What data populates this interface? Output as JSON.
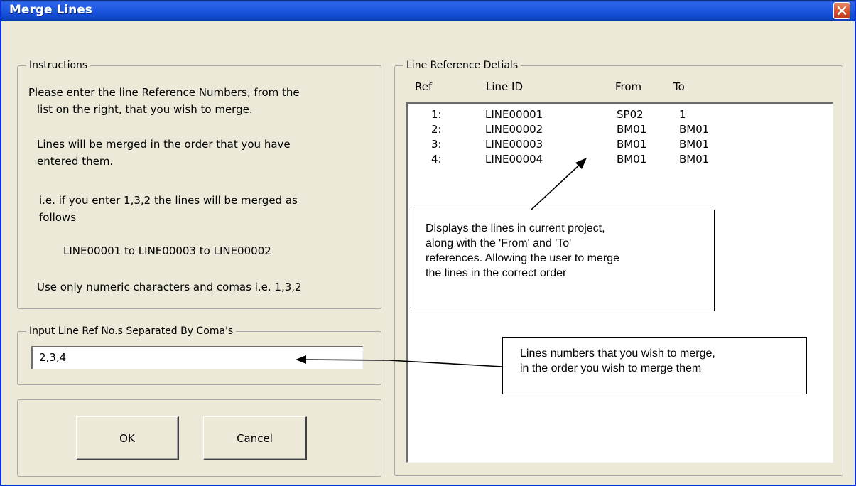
{
  "window": {
    "title": "Merge Lines"
  },
  "instructions": {
    "legend": "Instructions",
    "lines": [
      "Please enter the line Reference Numbers, from the",
      "list on the right, that you wish to merge.",
      "Lines will be merged in the order that you have",
      "entered them.",
      "i.e. if you enter 1,3,2 the lines will be merged as",
      "follows",
      "LINE00001 to LINE00003 to LINE00002",
      "Use only numeric characters and comas i.e. 1,3,2"
    ]
  },
  "input_group": {
    "legend": "Input Line Ref No.s Separated By Coma's",
    "value": "2,3,4"
  },
  "buttons": {
    "ok": "OK",
    "cancel": "Cancel"
  },
  "details": {
    "legend": "Line Reference Detials",
    "columns": [
      "Ref",
      "Line ID",
      "From",
      "To"
    ],
    "rows": [
      {
        "ref": "1:",
        "line_id": "LINE00001",
        "from": "SP02",
        "to": "1"
      },
      {
        "ref": "2:",
        "line_id": "LINE00002",
        "from": "BM01",
        "to": "BM01"
      },
      {
        "ref": "3:",
        "line_id": "LINE00003",
        "from": "BM01",
        "to": "BM01"
      },
      {
        "ref": "4:",
        "line_id": "LINE00004",
        "from": "BM01",
        "to": "BM01"
      }
    ]
  },
  "callouts": {
    "list_note": [
      "Displays the lines in current project,",
      "along with the 'From' and 'To'",
      "references. Allowing the user to merge",
      "the lines in the correct order"
    ],
    "input_note": [
      "Lines numbers that you wish to merge,",
      "in the order you wish to merge them"
    ]
  }
}
